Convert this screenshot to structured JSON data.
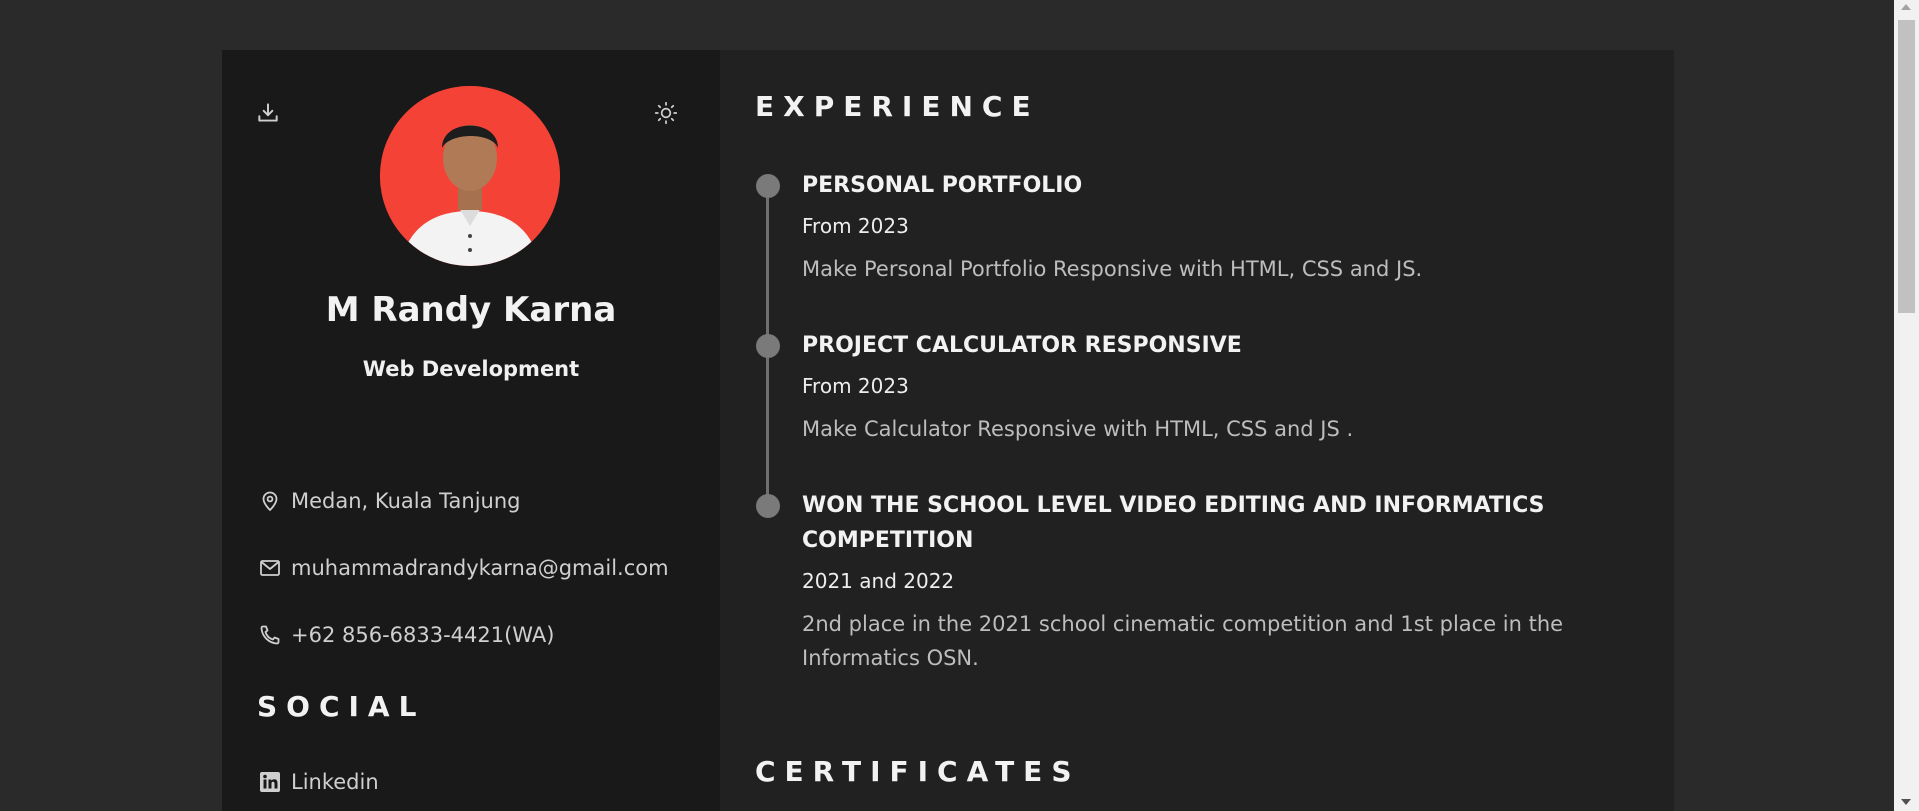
{
  "profile": {
    "name": "M Randy Karna",
    "role": "Web Development",
    "photo_background": "#f44336"
  },
  "toolbar": {
    "download_icon": "download-icon",
    "theme_icon": "sun-icon"
  },
  "contact": {
    "location": "Medan, Kuala Tanjung",
    "email": "muhammadrandykarna@gmail.com",
    "phone": "+62 856-6833-4421(WA)"
  },
  "social": {
    "title": "SOCIAL",
    "items": [
      {
        "label": "Linkedin",
        "icon": "linkedin-icon"
      }
    ]
  },
  "experience": {
    "title": "EXPERIENCE",
    "items": [
      {
        "title": "PERSONAL PORTFOLIO",
        "date": "From 2023",
        "description": "Make Personal Portfolio Responsive with HTML, CSS and JS."
      },
      {
        "title": "PROJECT CALCULATOR RESPONSIVE",
        "date": "From 2023",
        "description": "Make Calculator Responsive with HTML, CSS and JS ."
      },
      {
        "title": "WON THE SCHOOL LEVEL VIDEO EDITING AND INFORMATICS COMPETITION",
        "date": "2021 and 2022",
        "description": "2nd place in the 2021 school cinematic competition and 1st place in the Informatics OSN."
      }
    ]
  },
  "certificates": {
    "title": "CERTIFICATES"
  },
  "colors": {
    "page_background": "#2a2a2a",
    "sidebar_background": "#1a191a",
    "content_background": "#212121",
    "accent_avatar": "#f44336"
  }
}
